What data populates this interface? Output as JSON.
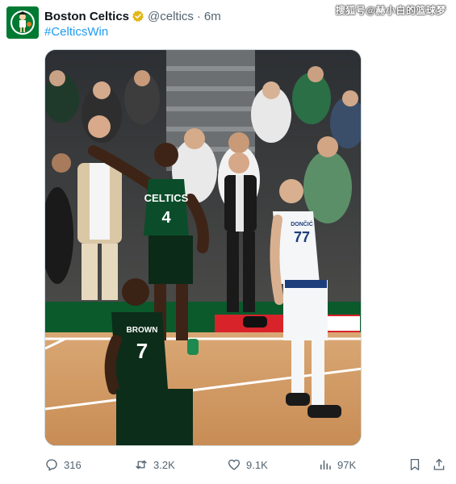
{
  "tweet": {
    "display_name": "Boston Celtics",
    "verified": true,
    "handle": "@celtics",
    "separator": "·",
    "time": "6m",
    "hashtag": "#CelticsWin",
    "media": {
      "alt": "Celtics player celebrating on court while a Mavericks player looks on",
      "jersey_home": "CELTICS",
      "jersey_home_number": "4",
      "jersey_back_number": "7",
      "jersey_back_name": "BROWN",
      "jersey_away_number": "77",
      "jersey_away_name": "DONČIĆ"
    }
  },
  "watermark": "搜狐号@赫小白的篮球梦",
  "actions": {
    "replies": "316",
    "retweets": "3.2K",
    "likes": "9.1K",
    "views": "97K"
  },
  "icons": {
    "avatar": "celtics-logo",
    "verified": "gold-verified-badge",
    "reply": "speech-bubble-icon",
    "retweet": "retweet-arrows-icon",
    "like": "heart-icon",
    "views": "bar-chart-icon",
    "bookmark": "bookmark-icon",
    "share": "share-upload-icon"
  },
  "colors": {
    "link": "#1d9bf0",
    "secondary_text": "#536471",
    "celtics_green": "#007a33",
    "verified_gold": "#e2b719"
  }
}
